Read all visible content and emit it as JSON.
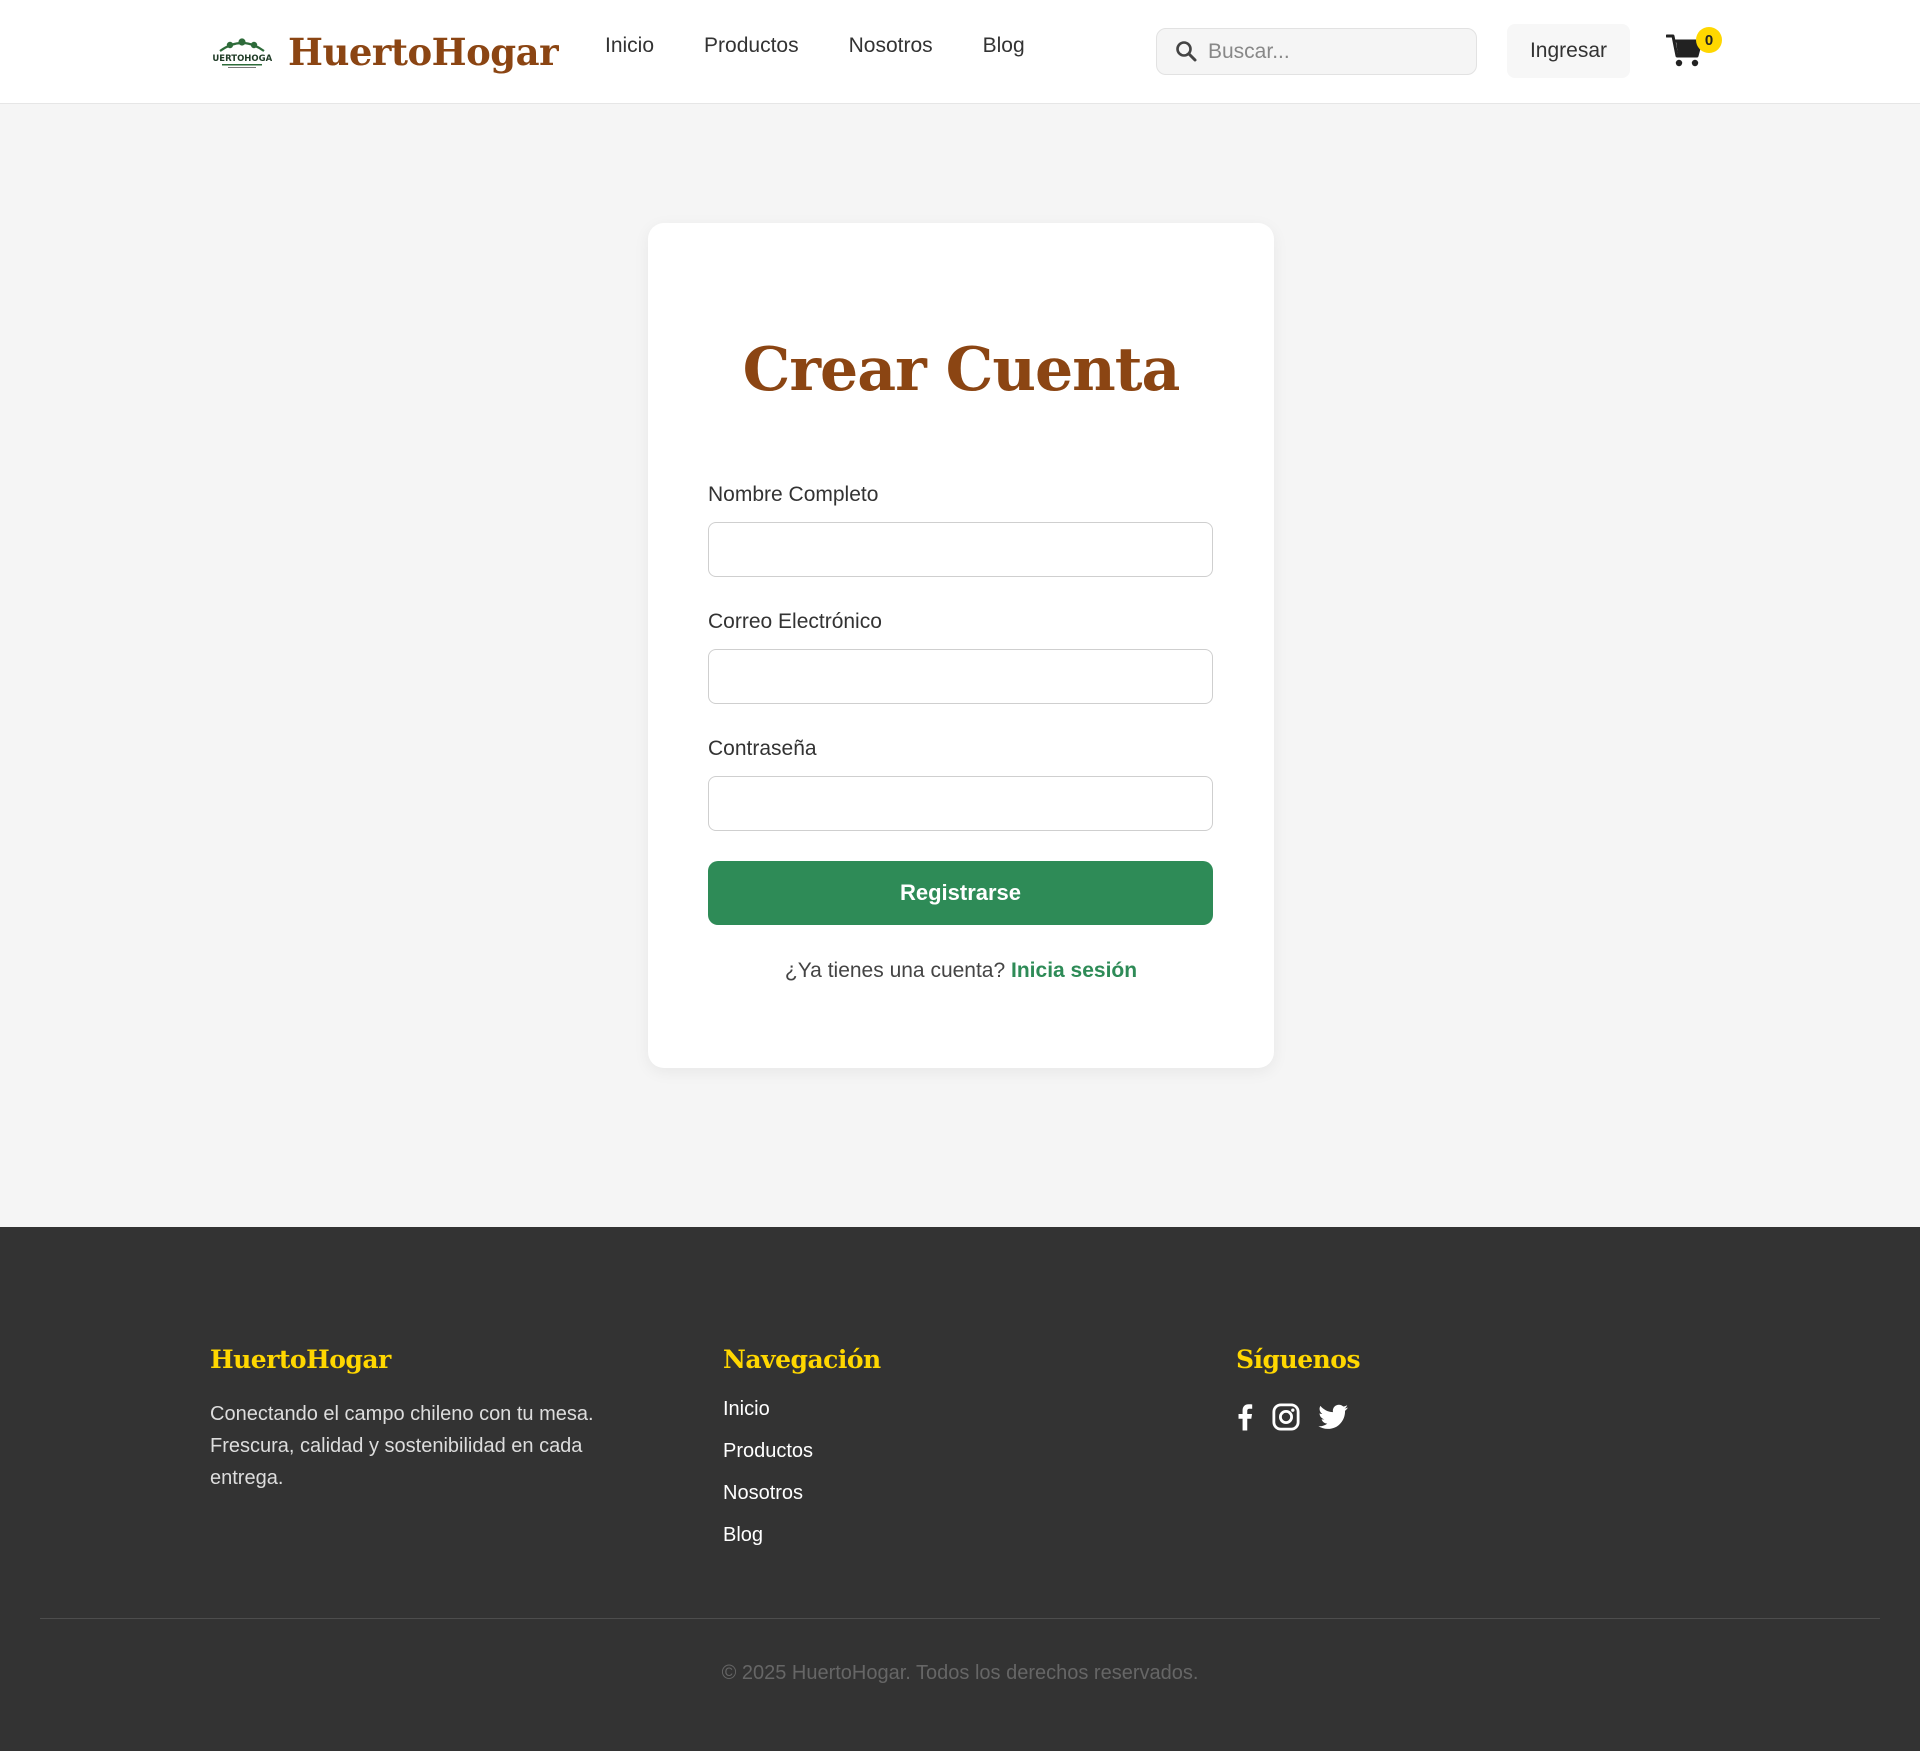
{
  "header": {
    "brand": "HuertoHogar",
    "logo_badge_text": "HUERTOHOGAR",
    "nav": [
      "Inicio",
      "Productos",
      "Nosotros",
      "Blog"
    ],
    "search_placeholder": "Buscar...",
    "login_label": "Ingresar",
    "cart_count": "0"
  },
  "form": {
    "title": "Crear Cuenta",
    "name_label": "Nombre Completo",
    "name_value": "",
    "email_label": "Correo Electrónico",
    "email_value": "",
    "password_label": "Contraseña",
    "password_value": "",
    "submit_label": "Registrarse",
    "prompt_text": "¿Ya tienes una cuenta?",
    "prompt_link": "Inicia sesión"
  },
  "footer": {
    "about_heading": "HuertoHogar",
    "about_text": "Conectando el campo chileno con tu mesa. Frescura, calidad y sostenibilidad en cada entrega.",
    "nav_heading": "Navegación",
    "nav_links": [
      "Inicio",
      "Productos",
      "Nosotros",
      "Blog"
    ],
    "social_heading": "Síguenos",
    "social_icons": [
      "facebook-icon",
      "instagram-icon",
      "twitter-icon"
    ],
    "copyright": "© 2025 HuertoHogar. Todos los derechos reservados."
  },
  "colors": {
    "brand_brown": "#8B4513",
    "primary_green": "#2E8B57",
    "accent_yellow": "#FFD700",
    "footer_bg": "#333333",
    "page_bg": "#f5f5f5"
  }
}
